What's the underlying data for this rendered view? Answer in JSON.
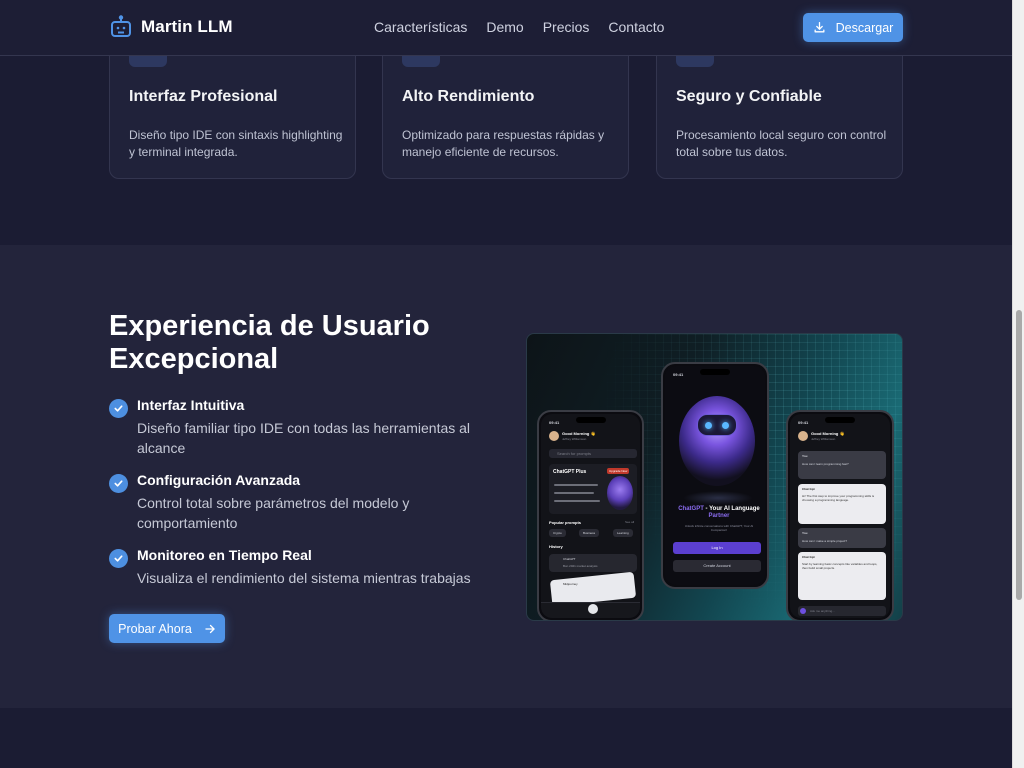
{
  "brand": {
    "name": "Martin LLM",
    "icon": "robot-icon"
  },
  "nav": {
    "links": [
      "Características",
      "Demo",
      "Precios",
      "Contacto"
    ],
    "download_label": "Descargar",
    "download_icon": "download-icon"
  },
  "features": [
    {
      "title": "Interfaz Profesional",
      "desc": "Diseño tipo IDE con sintaxis highlighting y terminal integrada."
    },
    {
      "title": "Alto Rendimiento",
      "desc": "Optimizado para respuestas rápidas y manejo eficiente de recursos."
    },
    {
      "title": "Seguro y Confiable",
      "desc": "Procesamiento local seguro con control total sobre tus datos."
    }
  ],
  "experience": {
    "title": "Experiencia de Usuario Excepcional",
    "items": [
      {
        "title": "Interfaz Intuitiva",
        "desc": "Diseño familiar tipo IDE con todas las herramientas al alcance"
      },
      {
        "title": "Configuración Avanzada",
        "desc": "Control total sobre parámetros del modelo y comportamiento"
      },
      {
        "title": "Monitoreo en Tiempo Real",
        "desc": "Visualiza el rendimiento del sistema mientras trabajas"
      }
    ],
    "cta_label": "Probar Ahora",
    "cta_icon": "arrow-right-icon"
  },
  "showcase": {
    "left_phone": {
      "time": "09:41",
      "greeting": "Good Morning 👋",
      "user": "Jeffrey Williamson",
      "search_placeholder": "Search for prompts",
      "plus_title": "ChatGPT Plus",
      "plus_badge": "Upgrade Now",
      "popular": "Popular prompts",
      "see_all": "See all",
      "chips": [
        "Crypto",
        "Business",
        "Learning"
      ],
      "history": "History",
      "history_items": [
        "ChatGPT",
        "Bon 2021 market analysis",
        "Midjourney"
      ]
    },
    "center_phone": {
      "time": "09:41",
      "headline_brand": "ChatGPT",
      "headline_rest": " - Your AI Language ",
      "headline_accent": "Partner",
      "sub": "Unlock infinite conversations with ChatGPT, Your AI Companion!",
      "login": "Log In",
      "create": "Create Account"
    },
    "right_phone": {
      "time": "09:41",
      "greeting": "Good Morning 👋",
      "user": "Jeffrey Williamson",
      "you": "You",
      "q1": "How can I learn programming fast?",
      "bot": "Chat Gpt",
      "a1": "Hi! The first step to improve your programming skills is choosing a programming language.",
      "q2": "How can I make a simple project?",
      "a2": "Start by learning basic concepts like variables and loops, then build small projects.",
      "input_placeholder": "Ask me anything..."
    }
  }
}
